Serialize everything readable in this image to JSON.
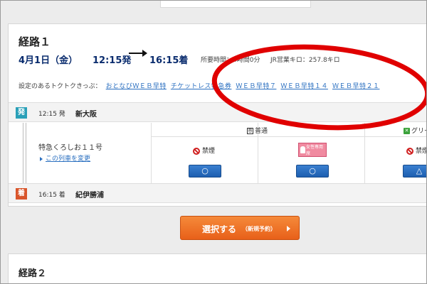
{
  "route1": {
    "title": "経路１",
    "date": "4月1日（金）",
    "dep_time": "12:15発",
    "arr_time": "16:15着",
    "duration_label": "所要時間：4時間0分",
    "distance_label": "JR営業キロ：257.8キロ",
    "tickets_label": "設定のあるトクトクきっぷ：",
    "tickets": [
      "おとなびＷＥＢ早特",
      "チケットレス特急券",
      "ＷＥＢ早特７",
      "ＷＥＢ早特１４",
      "ＷＥＢ早特２１"
    ],
    "departure": {
      "badge": "発",
      "time": "12:15 発",
      "station": "新大阪"
    },
    "train": {
      "name": "特急くろしお１１号",
      "change_label": "この列車を変更"
    },
    "seats": {
      "col1": {
        "header": "",
        "type": "禁煙",
        "availability": "○"
      },
      "col2": {
        "header": "普通",
        "type": "女性専用席",
        "availability": "○"
      },
      "col3": {
        "header": "グリー",
        "type": "禁煙",
        "availability": "△"
      }
    },
    "arrival": {
      "badge": "着",
      "time": "16:15 着",
      "station": "紀伊勝浦"
    }
  },
  "cta": {
    "label": "選択する",
    "sub": "（新規予約）"
  },
  "route2": {
    "title": "経路２"
  },
  "icons": {
    "green_car": "green-car-icon",
    "ordinary": "ordinary-car-icon",
    "no_smoking": "no-smoking-icon"
  },
  "colors": {
    "accent_blue": "#2a6fc0",
    "cta_orange": "#f07a2a",
    "dep_badge": "#2aa0b8",
    "arr_badge": "#d9552b",
    "annotation_red": "#e00000"
  }
}
